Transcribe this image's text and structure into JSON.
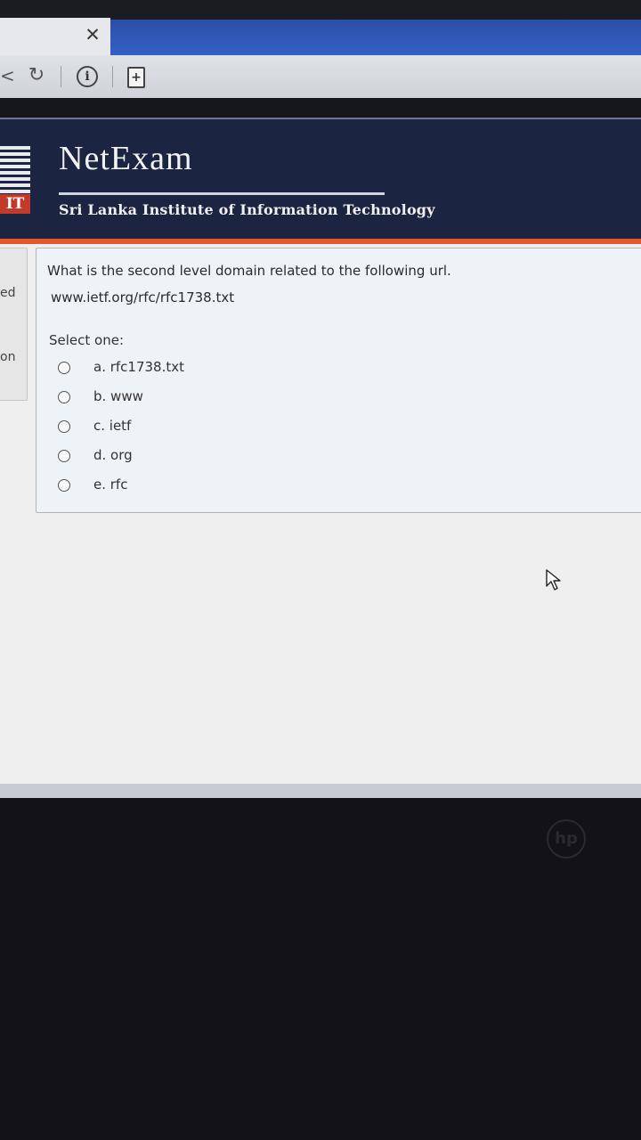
{
  "browser": {
    "close_icon_glyph": "✕",
    "back_glyph": "<",
    "reload_glyph": "↻",
    "info_glyph": "i",
    "page_glyph": "+"
  },
  "header": {
    "brand": "NetExam",
    "institute": "Sri Lanka Institute of Information Technology",
    "logo_text": "IT"
  },
  "leftnav": {
    "items": [
      "ed",
      "on"
    ]
  },
  "question": {
    "text": "What is the second level domain related to the following url.",
    "url": "www.ietf.org/rfc/rfc1738.txt",
    "select_label": "Select one:",
    "options": [
      {
        "label": "a. rfc1738.txt"
      },
      {
        "label": "b. www"
      },
      {
        "label": "c. ietf"
      },
      {
        "label": "d. org"
      },
      {
        "label": "e. rfc"
      }
    ]
  },
  "bezel": {
    "logo": "hp"
  },
  "colors": {
    "header_bg": "#1b2440",
    "accent_orange": "#e5562a",
    "tab_blue": "#3560c4"
  }
}
